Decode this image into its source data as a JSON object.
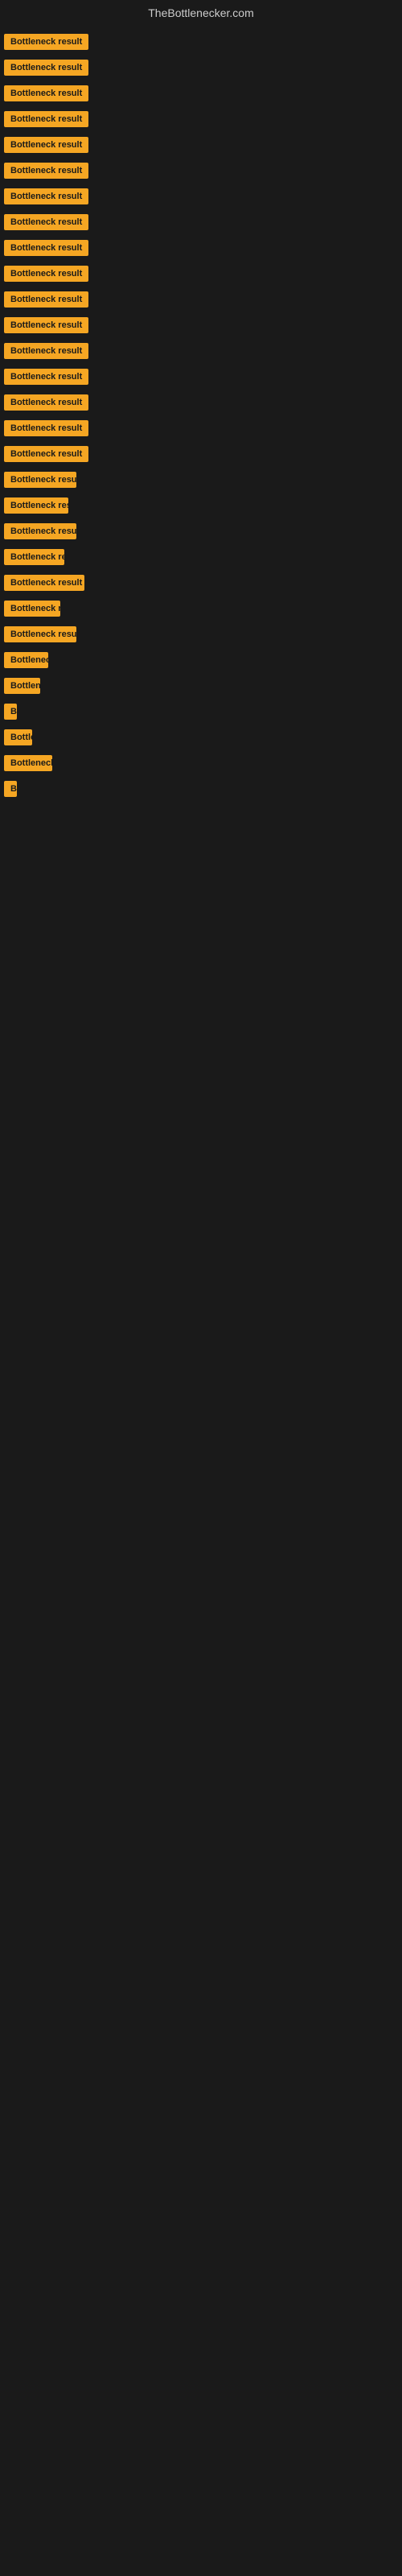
{
  "site": {
    "title": "TheBottlenecker.com"
  },
  "results": [
    {
      "id": 1,
      "label": "Bottleneck result",
      "width_class": "full"
    },
    {
      "id": 2,
      "label": "Bottleneck result",
      "width_class": "full"
    },
    {
      "id": 3,
      "label": "Bottleneck result",
      "width_class": "full"
    },
    {
      "id": 4,
      "label": "Bottleneck result",
      "width_class": "full"
    },
    {
      "id": 5,
      "label": "Bottleneck result",
      "width_class": "full"
    },
    {
      "id": 6,
      "label": "Bottleneck result",
      "width_class": "full"
    },
    {
      "id": 7,
      "label": "Bottleneck result",
      "width_class": "full"
    },
    {
      "id": 8,
      "label": "Bottleneck result",
      "width_class": "full"
    },
    {
      "id": 9,
      "label": "Bottleneck result",
      "width_class": "full"
    },
    {
      "id": 10,
      "label": "Bottleneck result",
      "width_class": "full"
    },
    {
      "id": 11,
      "label": "Bottleneck result",
      "width_class": "full"
    },
    {
      "id": 12,
      "label": "Bottleneck result",
      "width_class": "full"
    },
    {
      "id": 13,
      "label": "Bottleneck result",
      "width_class": "full"
    },
    {
      "id": 14,
      "label": "Bottleneck result",
      "width_class": "full"
    },
    {
      "id": 15,
      "label": "Bottleneck result",
      "width_class": "full"
    },
    {
      "id": 16,
      "label": "Bottleneck result",
      "width_class": "w120"
    },
    {
      "id": 17,
      "label": "Bottleneck result",
      "width_class": "full"
    },
    {
      "id": 18,
      "label": "Bottleneck result",
      "width_class": "w90"
    },
    {
      "id": 19,
      "label": "Bottleneck result",
      "width_class": "w80"
    },
    {
      "id": 20,
      "label": "Bottleneck result",
      "width_class": "w90"
    },
    {
      "id": 21,
      "label": "Bottleneck result",
      "width_class": "w75"
    },
    {
      "id": 22,
      "label": "Bottleneck result",
      "width_class": "w100"
    },
    {
      "id": 23,
      "label": "Bottleneck result",
      "width_class": "w70"
    },
    {
      "id": 24,
      "label": "Bottleneck result",
      "width_class": "w90"
    },
    {
      "id": 25,
      "label": "Bottleneck result",
      "width_class": "w55"
    },
    {
      "id": 26,
      "label": "Bottleneck result",
      "width_class": "w45"
    },
    {
      "id": 27,
      "label": "Bottleneck result",
      "width_class": "w10"
    },
    {
      "id": 28,
      "label": "Bottleneck result",
      "width_class": "w35"
    },
    {
      "id": 29,
      "label": "Bottleneck result",
      "width_class": "w60"
    },
    {
      "id": 30,
      "label": "Bottleneck result",
      "width_class": "w5"
    }
  ]
}
